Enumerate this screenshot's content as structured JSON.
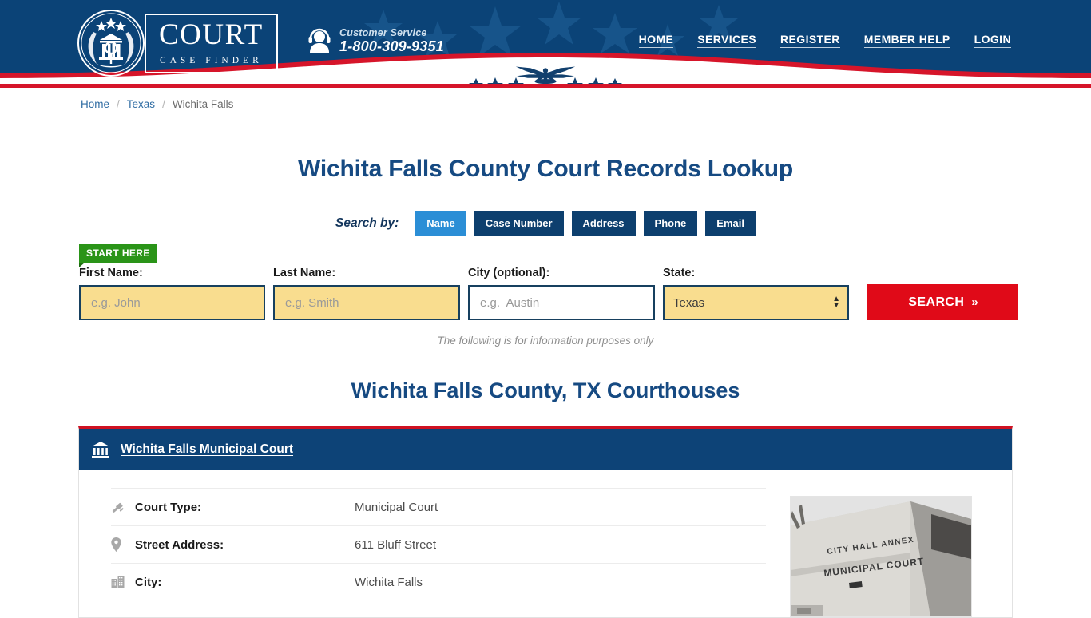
{
  "header": {
    "logo": {
      "title": "COURT",
      "subtitle": "CASE FINDER",
      "seal_icon": "court-seal-icon"
    },
    "customer_service": {
      "icon": "headset-support-icon",
      "label": "Customer Service",
      "phone": "1-800-309-9351"
    },
    "nav": [
      {
        "label": "HOME"
      },
      {
        "label": "SERVICES"
      },
      {
        "label": "REGISTER"
      },
      {
        "label": "MEMBER HELP"
      },
      {
        "label": "LOGIN"
      }
    ],
    "colors": {
      "navy": "#0b4377",
      "red": "#d6152a",
      "white": "#ffffff"
    }
  },
  "breadcrumb": {
    "home": "Home",
    "state": "Texas",
    "current": "Wichita Falls",
    "separator": "/"
  },
  "main": {
    "page_title": "Wichita Falls County Court Records Lookup",
    "search_by_label": "Search by:",
    "tabs": [
      {
        "label": "Name",
        "active": true
      },
      {
        "label": "Case Number",
        "active": false
      },
      {
        "label": "Address",
        "active": false
      },
      {
        "label": "Phone",
        "active": false
      },
      {
        "label": "Email",
        "active": false
      }
    ],
    "start_badge": "START HERE",
    "form": {
      "first_name": {
        "label": "First Name:",
        "placeholder": "e.g. John",
        "value": ""
      },
      "last_name": {
        "label": "Last Name:",
        "placeholder": "e.g. Smith",
        "value": ""
      },
      "city": {
        "label": "City (optional):",
        "placeholder": "e.g.  Austin",
        "value": ""
      },
      "state": {
        "label": "State:",
        "selected": "Texas"
      },
      "search_button": "SEARCH",
      "search_chevron": "»"
    },
    "disclaimer": "The following is for information purposes only",
    "section_title": "Wichita Falls County, TX Courthouses"
  },
  "court_card": {
    "icon": "bank-columns-icon",
    "name": "Wichita Falls Municipal Court",
    "rows": [
      {
        "icon": "gavel-icon",
        "key": "Court Type:",
        "value": "Municipal Court"
      },
      {
        "icon": "map-pin-icon",
        "key": "Street Address:",
        "value": "611 Bluff Street"
      },
      {
        "icon": "building-icon",
        "key": "City:",
        "value": "Wichita Falls"
      }
    ],
    "photo": {
      "name": "courthouse-photo",
      "sign_line1": "CITY HALL ANNEX",
      "sign_line2": "MUNICIPAL COURT"
    }
  }
}
